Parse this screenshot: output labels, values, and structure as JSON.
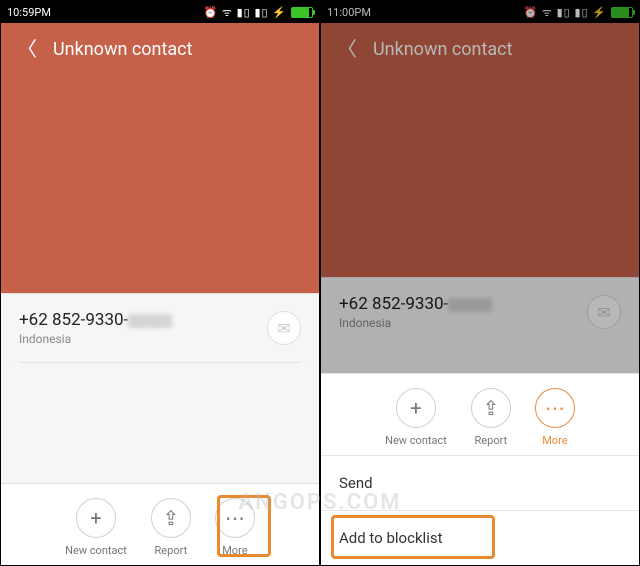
{
  "left": {
    "status": {
      "time": "10:59PM",
      "icons": "⏰ ᯤ ▮▯ ▮▯ ⚡"
    },
    "header": {
      "title": "Unknown contact"
    },
    "contact": {
      "number_prefix": "+62 852-9330-",
      "country": "Indonesia"
    },
    "toolbar": {
      "new_contact": {
        "label": "New contact",
        "symbol": "+"
      },
      "report": {
        "label": "Report",
        "symbol": "⇪"
      },
      "more": {
        "label": "More",
        "symbol": "⋯"
      }
    }
  },
  "right": {
    "status": {
      "time": "11:00PM",
      "icons": "⏰ ᯤ ▮▯ ▮▯ ⚡"
    },
    "header": {
      "title": "Unknown contact"
    },
    "contact": {
      "number_prefix": "+62 852-9330-",
      "country": "Indonesia"
    },
    "toolbar": {
      "new_contact": {
        "label": "New contact",
        "symbol": "+"
      },
      "report": {
        "label": "Report",
        "symbol": "⇪"
      },
      "more": {
        "label": "More",
        "symbol": "⋯"
      }
    },
    "menu": {
      "send": "Send",
      "add_blocklist": "Add to blocklist"
    }
  },
  "watermark": "ANGOPS.COM"
}
